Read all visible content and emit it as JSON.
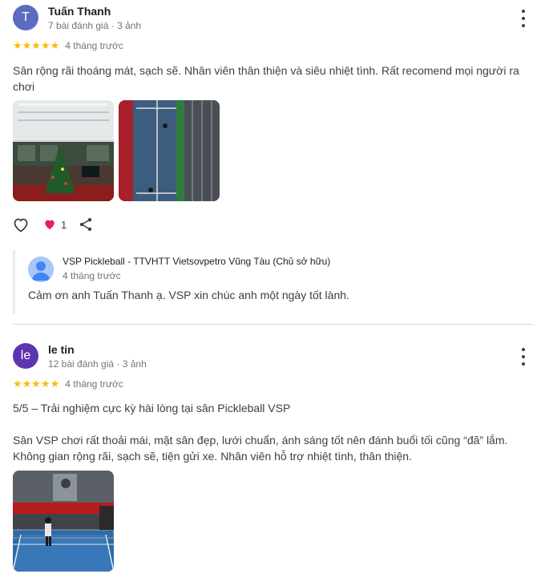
{
  "colors": {
    "star": "#fbbc04",
    "heart": "#e91e63",
    "avatar_1": "#5c6bc0",
    "avatar_2": "#5e35b1"
  },
  "reviews": [
    {
      "avatar_letter": "T",
      "name": "Tuấn Thanh",
      "meta": "7 bài đánh giá · 3 ảnh",
      "stars": "★★★★★",
      "rating": 5,
      "time": "4 tháng trước",
      "text": "Sân rộng rãi thoáng mát, sạch sẽ. Nhân viên thân thiện và siêu nhiệt tình. Rất recomend mọi người ra chơi",
      "reaction_count": "1",
      "owner_reply": {
        "name": "VSP Pickleball - TTVHTT Vietsovpetro Vũng Tàu (Chủ sở hữu)",
        "time": "4 tháng trước",
        "text": "Cảm ơn anh Tuấn Thanh ạ. VSP xin chúc anh một ngày tốt lành."
      }
    },
    {
      "avatar_letter": "le",
      "name": "le tin",
      "meta": "12 bài đánh giá · 3 ảnh",
      "stars": "★★★★★",
      "rating": 5,
      "time": "4 tháng trước",
      "text_p1": "5/5 – Trải nghiệm cực kỳ hài lòng tại sân Pickleball VSP",
      "text_p2": "Sân VSP chơi rất thoải mái, mặt sân đẹp, lưới chuẩn, ánh sáng tốt nên đánh buổi tối cũng “đã” lắm. Không gian rộng rãi, sạch sẽ, tiện gửi xe. Nhân viên hỗ trợ nhiệt tình, thân thiện."
    }
  ],
  "icons": {
    "more": "more-vert-icon",
    "like": "heart-outline-icon",
    "reaction": "heart-filled-icon",
    "share": "share-icon"
  }
}
